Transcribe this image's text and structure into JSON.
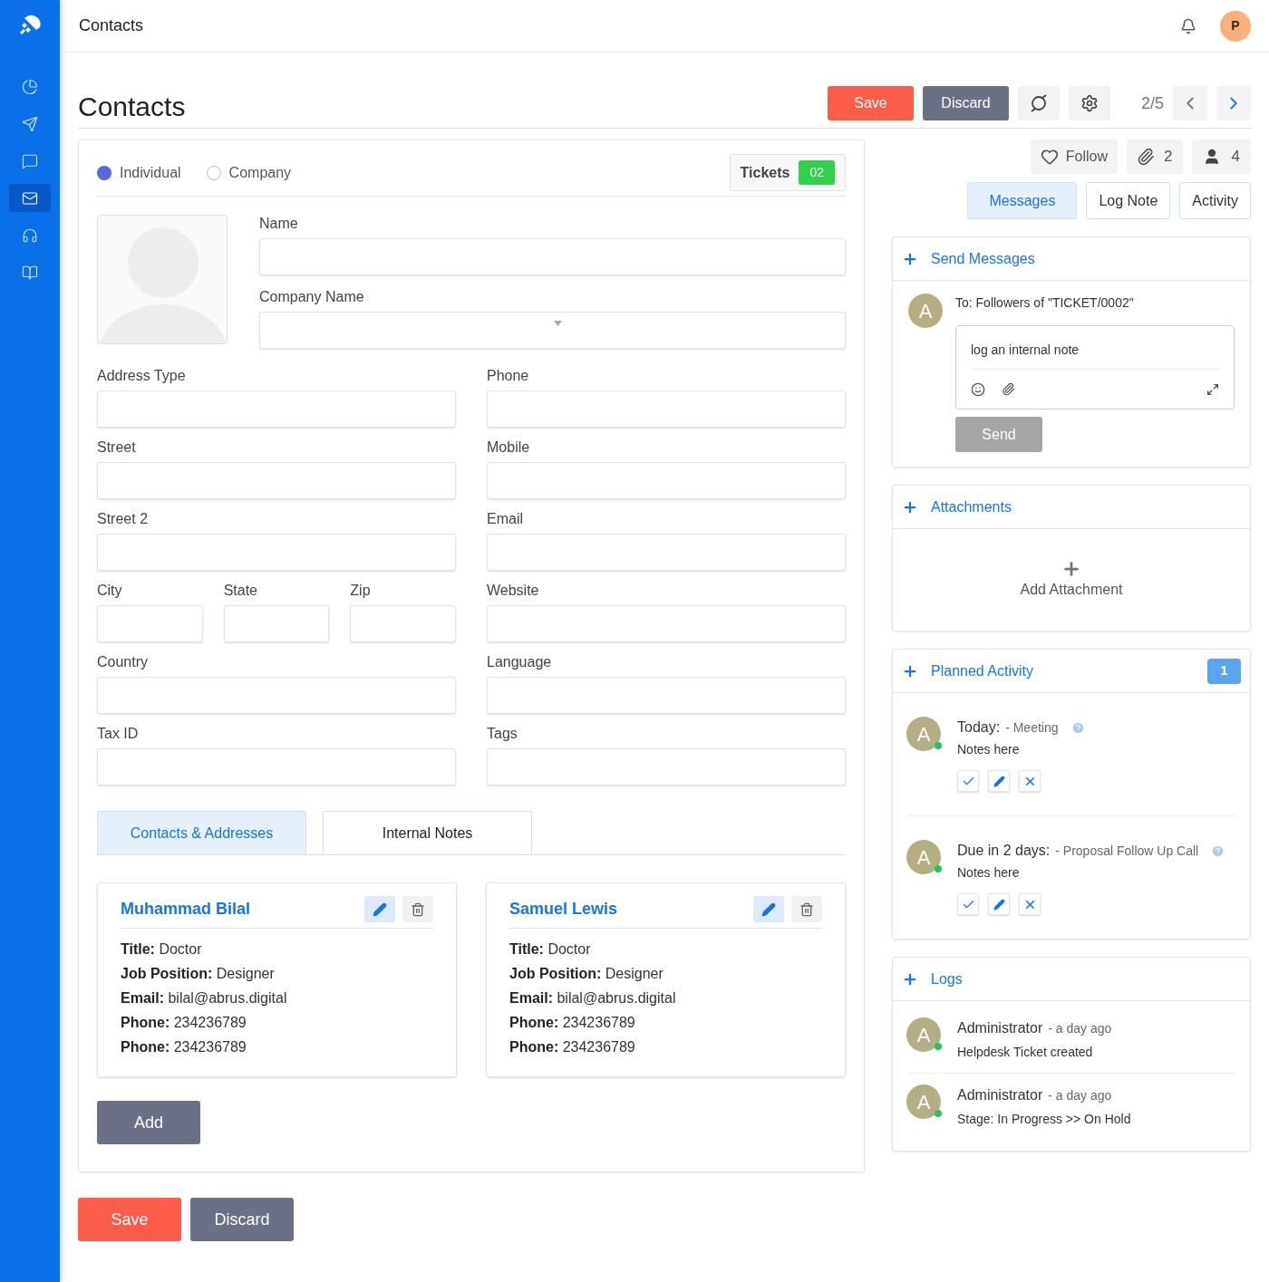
{
  "sidebar": {
    "items": [
      {
        "kind": "chart",
        "selected": false
      },
      {
        "kind": "send",
        "selected": false
      },
      {
        "kind": "chat",
        "selected": false
      },
      {
        "kind": "mail",
        "selected": true
      },
      {
        "kind": "headset",
        "selected": false
      },
      {
        "kind": "book",
        "selected": false
      }
    ]
  },
  "topbar": {
    "title": "Contacts",
    "avatar": "P"
  },
  "page": {
    "title": "Contacts",
    "save": "Save",
    "discard": "Discard",
    "pager": "2/5"
  },
  "form": {
    "contact_types": [
      {
        "label": "Individual",
        "selected": true
      },
      {
        "label": "Company",
        "selected": false
      }
    ],
    "tickets": {
      "label": "Tickets",
      "count": "02"
    },
    "top_fields": [
      {
        "label": "Name",
        "kind": "text"
      },
      {
        "label": "Company Name",
        "kind": "select"
      }
    ],
    "left_rows": [
      {
        "fields": [
          "Address Type"
        ]
      },
      {
        "fields": [
          "Street"
        ]
      },
      {
        "fields": [
          "Street 2"
        ]
      },
      {
        "fields": [
          "City",
          "State",
          "Zip"
        ]
      },
      {
        "fields": [
          "Country"
        ]
      },
      {
        "fields": [
          "Tax ID"
        ]
      }
    ],
    "right_fields": [
      "Phone",
      "Mobile",
      "Email",
      "Website",
      "Language",
      "Tags"
    ],
    "tabs": [
      {
        "label": "Contacts & Addresses",
        "selected": true
      },
      {
        "label": "Internal Notes",
        "selected": false
      }
    ],
    "contacts": [
      {
        "name": "Muhammad Bilal",
        "lines": [
          "**Title:** Doctor",
          "**Job Position:** Designer",
          "**Email:** bilal@abrus.digital",
          "**Phone:** 234236789",
          "**Phone:** 234236789"
        ]
      },
      {
        "name": "Samuel Lewis",
        "lines": [
          "**Title:** Doctor",
          "**Job Position:** Designer",
          "**Email:** bilal@abrus.digital",
          "**Phone:** 234236789",
          "**Phone:** 234236789"
        ]
      }
    ],
    "add": "Add"
  },
  "bottom_actions": {
    "save": "Save",
    "discard": "Discard"
  },
  "chatter": {
    "follow": "Follow",
    "attachments_count": "2",
    "followers_count": "4",
    "tabs": [
      {
        "label": "Messages",
        "selected": true
      },
      {
        "label": "Log Note",
        "selected": false
      },
      {
        "label": "Activity",
        "selected": false
      }
    ],
    "send_messages": {
      "title": "Send Messages",
      "avatar": "A",
      "recipient": "To: Followers of \"TICKET/0002\"",
      "placeholder": "log an internal note",
      "send": "Send",
      "send_disabled": true
    },
    "attachments": {
      "title": "Attachments",
      "add": "Add Attachment"
    },
    "planned": {
      "title": "Planned Activity",
      "badge": "1",
      "items": [
        {
          "avatar": "A",
          "online": true,
          "due": "Today:",
          "summary": "- Meeting",
          "note": "Notes here"
        },
        {
          "avatar": "A",
          "online": true,
          "due": "Due in 2 days:",
          "summary": "- Proposal Follow Up Call",
          "note": "Notes here"
        }
      ]
    },
    "logs": {
      "title": "Logs",
      "entries": [
        {
          "avatar": "A",
          "online": true,
          "author": "Administrator",
          "time": "- a day ago",
          "message": "Helpdesk Ticket created"
        },
        {
          "avatar": "A",
          "online": true,
          "author": "Administrator",
          "time": "- a day ago",
          "message": "Stage: In Progress >> On Hold"
        }
      ]
    }
  }
}
